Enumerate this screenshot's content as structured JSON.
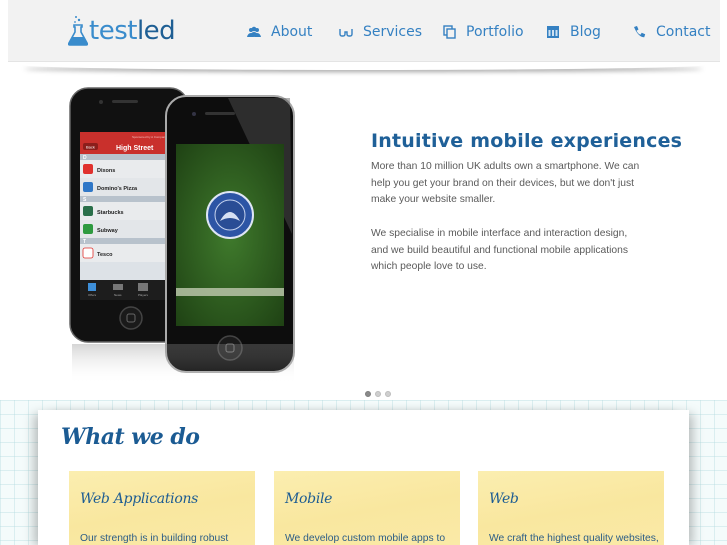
{
  "brand": {
    "logo_text_light": "test",
    "logo_text_dark": "led",
    "logo_icon": "flask-icon",
    "colors": {
      "primary": "#3581c2",
      "dark": "#1f5f94",
      "header_bg": "#f2f2f2",
      "card_bg": "#f9e79f"
    }
  },
  "nav": {
    "items": [
      {
        "label": "About",
        "icon": "people-icon"
      },
      {
        "label": "Services",
        "icon": "glasses-icon"
      },
      {
        "label": "Portfolio",
        "icon": "copy-icon"
      },
      {
        "label": "Blog",
        "icon": "calendar-icon"
      },
      {
        "label": "Contact",
        "icon": "phone-icon"
      }
    ]
  },
  "hero": {
    "title": "Intuitive mobile experiences",
    "paragraphs": [
      "More than 10 million UK adults own a smartphone. We can help you get your brand on their devices, but we don't just make your website smaller.",
      "We specialise in mobile interface and interaction design, and we build beautiful and functional mobile applications which people love to use."
    ],
    "phone_app": {
      "header_small": "Sponsored by A Company Ltd",
      "back_label": "Back",
      "title": "High Street",
      "sections": [
        {
          "letter": "D",
          "items": [
            "Dixons",
            "Domino's Pizza"
          ]
        },
        {
          "letter": "S",
          "items": [
            "Starbucks",
            "Subway"
          ]
        },
        {
          "letter": "T",
          "items": [
            "Tesco"
          ]
        }
      ],
      "tabs": [
        "Offers",
        "News",
        "Players"
      ]
    },
    "slider": {
      "total": 3,
      "active": 1
    }
  },
  "what_we_do": {
    "title": "What we do",
    "cards": [
      {
        "title": "Web Applications",
        "text": "Our strength is in building robust"
      },
      {
        "title": "Mobile",
        "text": "We develop custom mobile apps to"
      },
      {
        "title": "Web",
        "text": "We craft the highest quality websites,"
      }
    ]
  }
}
